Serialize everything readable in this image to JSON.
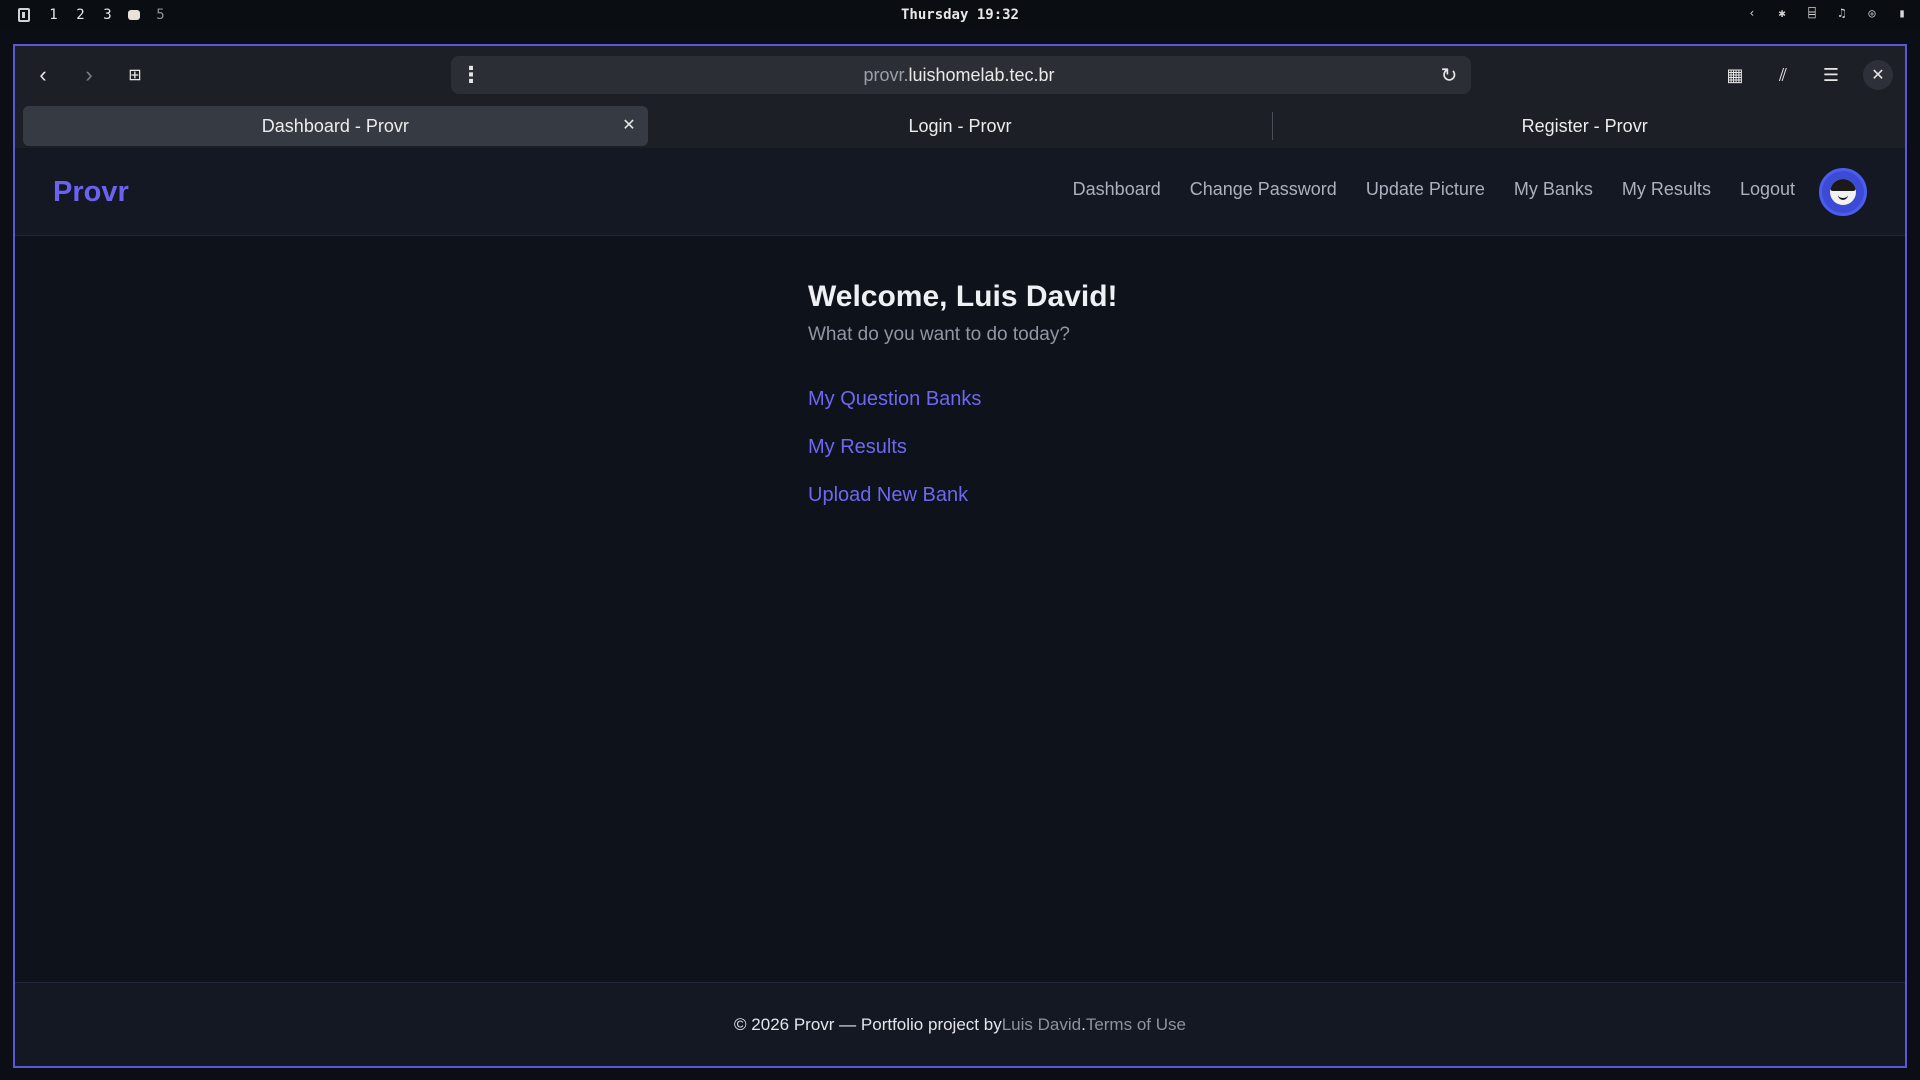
{
  "system_bar": {
    "workspaces": [
      "1",
      "2",
      "3",
      "5"
    ],
    "clock": "Thursday 19:32"
  },
  "browser": {
    "url_subdomain": "provr.",
    "url_domain": "luishomelab.tec.br",
    "tabs": [
      {
        "label": "Dashboard - Provr",
        "active": true
      },
      {
        "label": "Login - Provr",
        "active": false
      },
      {
        "label": "Register - Provr",
        "active": false
      }
    ]
  },
  "site": {
    "brand": "Provr",
    "nav": [
      "Dashboard",
      "Change Password",
      "Update Picture",
      "My Banks",
      "My Results",
      "Logout"
    ],
    "welcome": "Welcome, Luis David!",
    "subtitle": "What do you want to do today?",
    "actions": [
      "My Question Banks",
      "My Results",
      "Upload New Bank"
    ],
    "footer": {
      "prefix": "© 2026 Provr — Portfolio project by ",
      "author": "Luis David",
      "separator": ". ",
      "terms": "Terms of Use"
    }
  },
  "colors": {
    "accent": "#6b63f0",
    "window_border": "#5b57d9",
    "avatar_bg": "#3c4bd6"
  },
  "icons": [
    "back-icon",
    "forward-icon",
    "new-tab-icon",
    "page-menu-icon",
    "reload-icon",
    "grid-icon",
    "library-icon",
    "hamburger-menu-icon",
    "close-icon",
    "tab-close-icon",
    "bluetooth-icon",
    "network-icon",
    "headphones-icon",
    "globe-icon",
    "battery-icon"
  ]
}
